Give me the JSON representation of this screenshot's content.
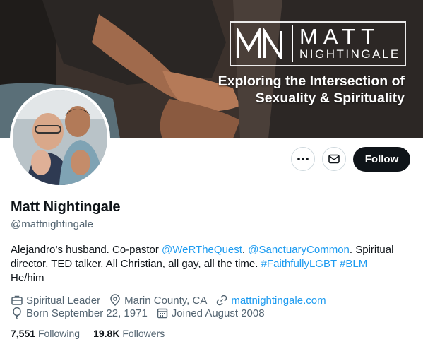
{
  "banner": {
    "brand_initials": "MN",
    "brand_name": "MATT",
    "brand_surname": "NIGHTINGALE",
    "tagline_line1": "Exploring the Intersection of",
    "tagline_line2": "Sexuality & Spirituality"
  },
  "actions": {
    "more_icon": "more-dots-icon",
    "message_icon": "envelope-icon",
    "follow_label": "Follow"
  },
  "profile": {
    "display_name": "Matt Nightingale",
    "handle": "@mattnightingale",
    "bio": {
      "text1": "Alejandro’s husband. Co-pastor ",
      "mention1": "@WeRTheQuest",
      "text2": ". ",
      "mention2": "@SanctuaryCommon",
      "text3": ". Spiritual director. TED talker. All Christian, all gay, all the time. ",
      "hashtag1": "#FaithfullyLGBT",
      "text4": " ",
      "hashtag2": "#BLM",
      "text5": " He/him"
    },
    "meta": {
      "profession": "Spiritual Leader",
      "location": "Marin County, CA",
      "website": "mattnightingale.com",
      "birthday": "Born September 22, 1971",
      "joined": "Joined August 2008"
    },
    "stats": {
      "following_count": "7,551",
      "following_label": "Following",
      "followers_count": "19.8K",
      "followers_label": "Followers"
    }
  },
  "colors": {
    "accent": "#1d9bf0",
    "text": "#0f1419",
    "secondary": "#536471",
    "follow_bg": "#0f1419"
  }
}
